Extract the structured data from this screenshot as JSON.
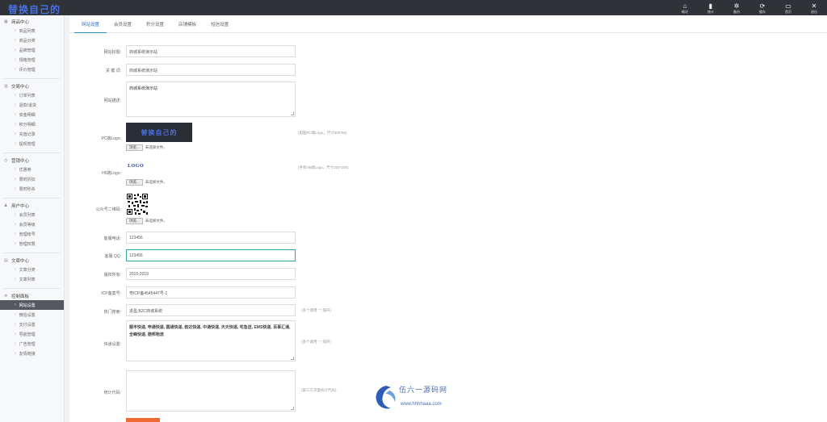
{
  "brand": "替换自己的",
  "topnav": [
    {
      "label": "概况",
      "icon": "home-icon",
      "glyph": "⌂"
    },
    {
      "label": "统计",
      "icon": "bar-chart-icon",
      "glyph": "▮"
    },
    {
      "label": "备份",
      "icon": "gear-icon",
      "glyph": "✲"
    },
    {
      "label": "缓存",
      "icon": "refresh-icon",
      "glyph": "⟳"
    },
    {
      "label": "首页",
      "icon": "monitor-icon",
      "glyph": "▭"
    },
    {
      "label": "退出",
      "icon": "close-icon",
      "glyph": "✕"
    }
  ],
  "sidebar": [
    {
      "title": "商品中心",
      "icon": "grid-icon",
      "items": [
        "商品列表",
        "商品分类",
        "品牌管理",
        "规格管理",
        "评价管理"
      ]
    },
    {
      "title": "交易中心",
      "icon": "chart-icon",
      "items": [
        "订单列表",
        "退款/退货",
        "资金明细",
        "积分明细",
        "充值记录",
        "提现管理"
      ]
    },
    {
      "title": "营销中心",
      "icon": "clock-icon",
      "items": [
        "优惠券",
        "限时折扣",
        "限时秒杀"
      ]
    },
    {
      "title": "用户中心",
      "icon": "user-icon",
      "items": [
        "会员列表",
        "会员等级",
        "管理帐号",
        "管理权限"
      ]
    },
    {
      "title": "文章中心",
      "icon": "document-icon",
      "items": [
        "文章分类",
        "文章列表"
      ]
    },
    {
      "title": "控制面板",
      "icon": "gear-icon",
      "items": [
        "网站设置",
        "微信设置",
        "支付设置",
        "导航管理",
        "广告管理",
        "友情链接"
      ]
    }
  ],
  "tabs": [
    "网站设置",
    "会员设置",
    "积分设置",
    "店铺模板",
    "短信设置"
  ],
  "form": {
    "site_title_label": "网站标题:",
    "site_title_value": "商城系统演示站",
    "keywords_label": "关 键 词:",
    "keywords_value": "商城系统演示站",
    "desc_label": "网站描述:",
    "desc_value": "商城系统演示站",
    "pc_logo_label": "PC端Logo:",
    "pc_logo_text": "替换自己的",
    "pc_logo_hint": "(电脑PC端Logo，尺寸300*55)",
    "h5_logo_label": "H5端Logo:",
    "h5_logo_text": "LOGO",
    "h5_logo_hint": "(手机H5端Logo，尺寸200*200)",
    "qr_label": "公众号二维码:",
    "browse_label": "浏览...",
    "no_file_label": "未选择文件。",
    "phone_label": "客服电话:",
    "phone_value": "123456",
    "qq_label": "客服 QQ:",
    "qq_value": "123456",
    "copyright_label": "版权所有:",
    "copyright_value": "2015-2019",
    "icp_label": "ICP备案号:",
    "icp_value": "粤ICP备4545447号-1",
    "hot_label": "热门搜索:",
    "hot_value": "进盈,B2C商城系统",
    "hot_hint": "(多个请用 \",\" 隔开)",
    "express_label": "快递设置:",
    "express_value": "顺丰快递, 申通快递, 圆通快递, 韵达快递, 中通快递, 天天快递, 宅急送, EMS快递, 百事汇通, 全峰快递, 德邦物流",
    "express_hint": "(多个请用 \",\" 隔开)",
    "stats_label": "统计代码:",
    "stats_value": "",
    "stats_hint": "(第三方流量统计代码)"
  },
  "watermark": {
    "line1": "伍六一源码网",
    "line2": "www.hhhhaaa.com"
  }
}
